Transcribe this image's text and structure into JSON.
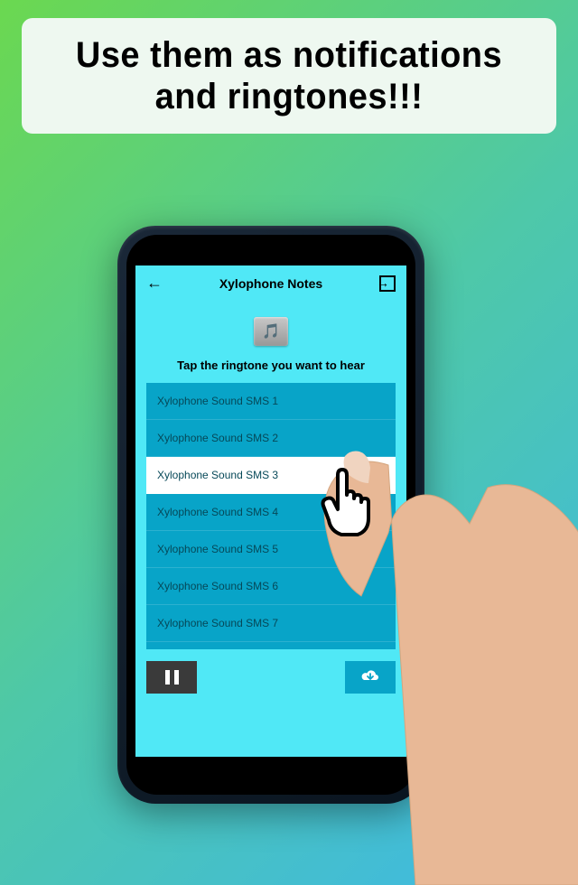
{
  "banner": {
    "text": "Use them as notifications and ringtones!!!"
  },
  "app": {
    "header_title": "Xylophone Notes",
    "instruction": "Tap the ringtone you want to hear"
  },
  "ringtones": {
    "items": [
      {
        "label": "Xylophone Sound SMS 1",
        "selected": false
      },
      {
        "label": "Xylophone Sound SMS 2",
        "selected": false
      },
      {
        "label": "Xylophone Sound SMS 3",
        "selected": true
      },
      {
        "label": "Xylophone Sound SMS 4",
        "selected": false
      },
      {
        "label": "Xylophone Sound SMS 5",
        "selected": false
      },
      {
        "label": "Xylophone Sound SMS 6",
        "selected": false
      },
      {
        "label": "Xylophone Sound SMS 7",
        "selected": false
      }
    ]
  }
}
